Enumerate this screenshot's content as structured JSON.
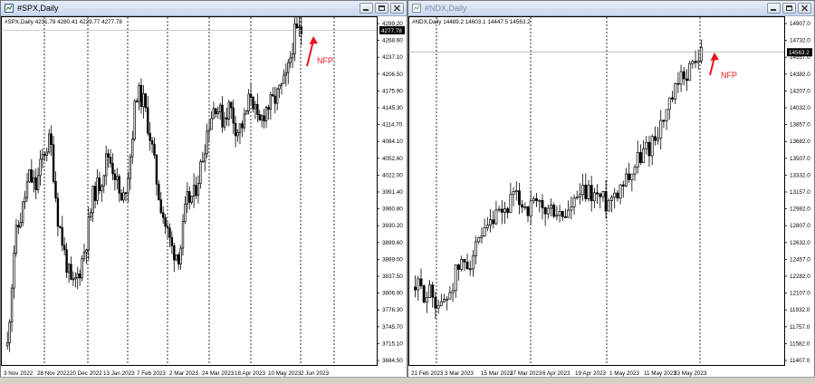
{
  "colors": {
    "annotation": "#e8141c",
    "grid": "#000000",
    "candle": "#000000",
    "price_label_bg": "#000000",
    "price_label_fg": "#ffffff"
  },
  "windows": [
    {
      "id": "spx",
      "title": "#SPX,Daily",
      "title_icon": "chart-window-icon",
      "legend": "#SPX,Daily  4231.78 4280.41 4229.77 4277.78",
      "current_price_label": "4277.78",
      "annotation": "NFP",
      "price_labels": [
        "4299.20",
        "4268.60",
        "4237.10",
        "4206.50",
        "4175.90",
        "4145.30",
        "4114.70",
        "4084.10",
        "4052.60",
        "4022.00",
        "3991.40",
        "3960.80",
        "3930.20",
        "3899.60",
        "3869.00",
        "3837.50",
        "3806.90",
        "3776.30",
        "3745.70",
        "3715.10",
        "3684.50"
      ],
      "date_labels": [
        "3 Nov 2022",
        "28 Nov 2022",
        "20 Dec 2022",
        "13 Jan 2023",
        "7 Feb 2023",
        "2 Mar 2023",
        "24 Mar 2023",
        "18 Apr 2023",
        "10 May 2023",
        "2 Jun 2023"
      ],
      "price_range": [
        3684.5,
        4299.2
      ],
      "current_price": 4277.78
    },
    {
      "id": "ndx",
      "title": "#NDX,Daily",
      "title_icon": "chart-window-icon",
      "legend": "#NDX,Daily  14489.2 14603.1 14447.5 14563.2",
      "current_price_label": "14563.2",
      "annotation": "NFP",
      "price_labels": [
        "14907.0",
        "14732.0",
        "14557.0",
        "14382.0",
        "14207.0",
        "14032.0",
        "13857.0",
        "13682.0",
        "13507.0",
        "13332.0",
        "13157.0",
        "12982.0",
        "12807.0",
        "12632.0",
        "12457.0",
        "12282.0",
        "12107.0",
        "11932.0",
        "11757.0",
        "11582.0",
        "11407.0"
      ],
      "date_labels": [
        "21 Feb 2023",
        "3 Mar 2023",
        "15 Mar 2023",
        "27 Mar 2023",
        "6 Apr 2023",
        "19 Apr 2023",
        "1 May 2023",
        "11 May 2023",
        "23 May 2023"
      ],
      "price_range": [
        11407.0,
        14907.0
      ],
      "current_price": 14563.2
    }
  ]
}
